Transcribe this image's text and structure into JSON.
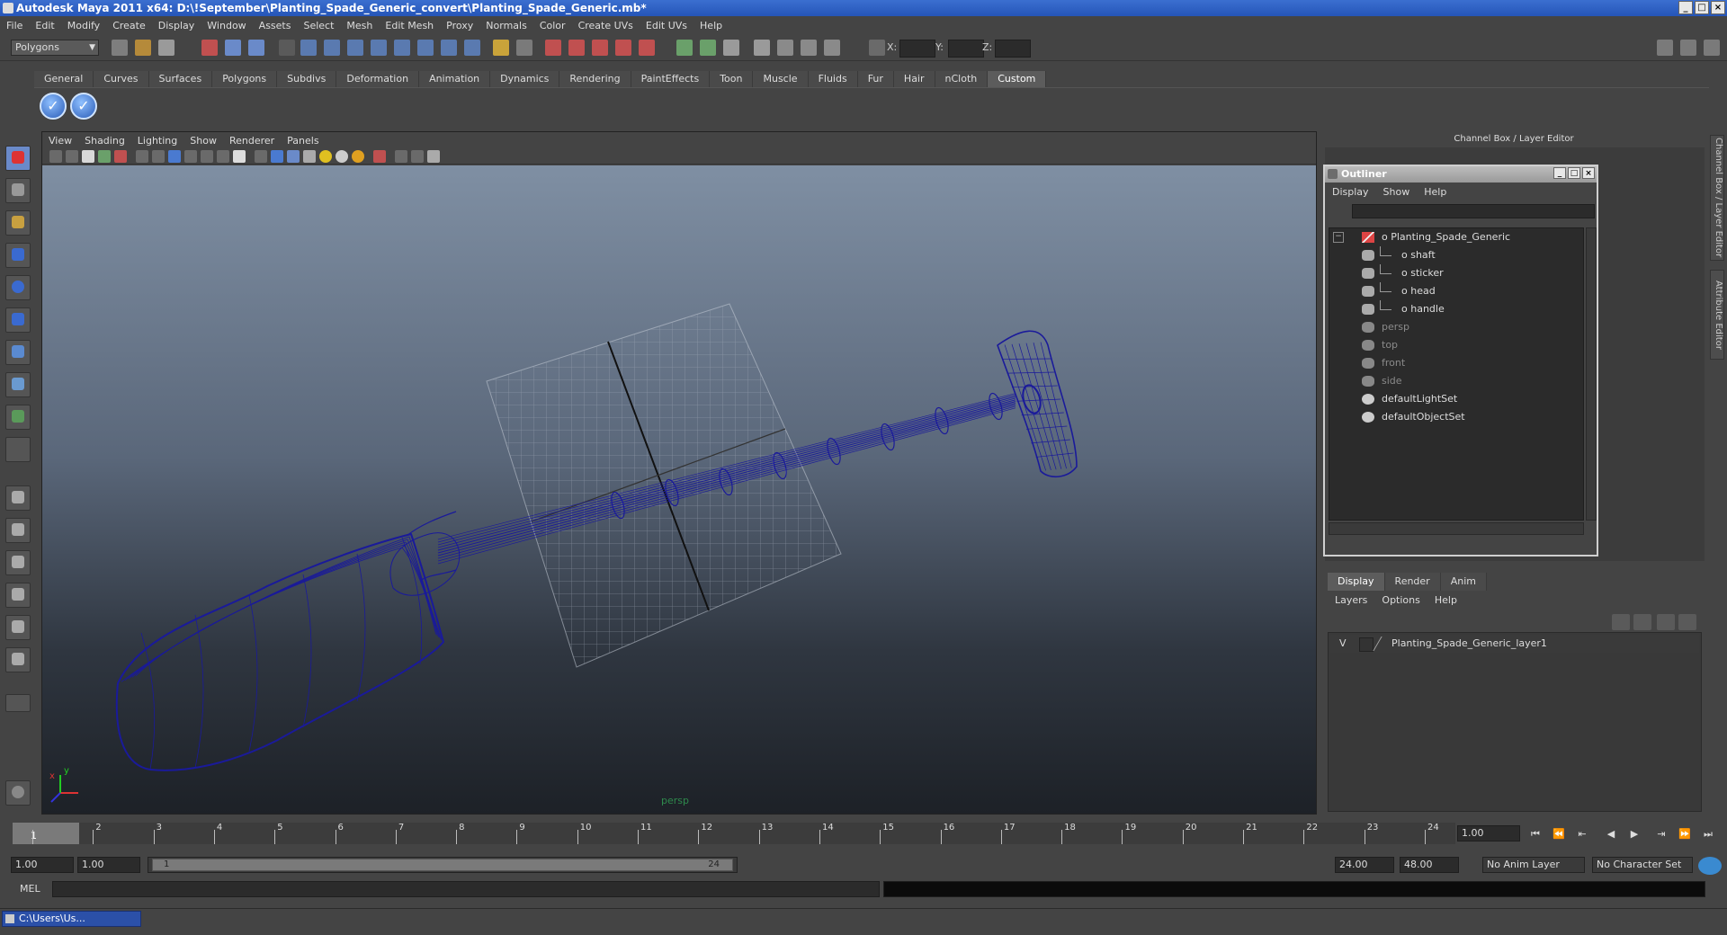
{
  "window": {
    "title": "Autodesk Maya 2011 x64: D:\\!September\\Planting_Spade_Generic_convert\\Planting_Spade_Generic.mb*",
    "minimize": "_",
    "maximize": "□",
    "close": "×"
  },
  "menubar": [
    "File",
    "Edit",
    "Modify",
    "Create",
    "Display",
    "Window",
    "Assets",
    "Select",
    "Mesh",
    "Edit Mesh",
    "Proxy",
    "Normals",
    "Color",
    "Create UVs",
    "Edit UVs",
    "Help"
  ],
  "statusline": {
    "mode": "Polygons",
    "x_label": "X:",
    "y_label": "Y:",
    "z_label": "Z:"
  },
  "shelf": {
    "tabs": [
      "General",
      "Curves",
      "Surfaces",
      "Polygons",
      "Subdivs",
      "Deformation",
      "Animation",
      "Dynamics",
      "Rendering",
      "PaintEffects",
      "Toon",
      "Muscle",
      "Fluids",
      "Fur",
      "Hair",
      "nCloth",
      "Custom"
    ],
    "active_tab": "Custom",
    "button_glyph": "✓"
  },
  "viewport": {
    "menu": [
      "View",
      "Shading",
      "Lighting",
      "Show",
      "Renderer",
      "Panels"
    ],
    "camera": "persp",
    "axis_x": "x",
    "axis_y": "y",
    "wire_color": "#1a1a9a"
  },
  "channelbox": {
    "title": "Channel Box / Layer Editor",
    "side_tabs": [
      "Channel Box / Layer Editor",
      "Attribute Editor"
    ]
  },
  "outliner": {
    "title": "Outliner",
    "menu": [
      "Display",
      "Show",
      "Help"
    ],
    "expand": "−",
    "items": [
      {
        "label": "Planting_Spade_Generic",
        "indent": 0,
        "dim": false
      },
      {
        "label": "shaft",
        "indent": 1,
        "dim": false
      },
      {
        "label": "sticker",
        "indent": 1,
        "dim": false
      },
      {
        "label": "head",
        "indent": 1,
        "dim": false
      },
      {
        "label": "handle",
        "indent": 1,
        "dim": false
      },
      {
        "label": "persp",
        "indent": 0,
        "dim": true
      },
      {
        "label": "top",
        "indent": 0,
        "dim": true
      },
      {
        "label": "front",
        "indent": 0,
        "dim": true
      },
      {
        "label": "side",
        "indent": 0,
        "dim": true
      },
      {
        "label": "defaultLightSet",
        "indent": 0,
        "dim": false
      },
      {
        "label": "defaultObjectSet",
        "indent": 0,
        "dim": false
      }
    ]
  },
  "layer_editor": {
    "tabs": [
      "Display",
      "Render",
      "Anim"
    ],
    "active_tab": "Display",
    "menu": [
      "Layers",
      "Options",
      "Help"
    ],
    "layer_visible": "V",
    "layer_name": "Planting_Spade_Generic_layer1"
  },
  "timeline": {
    "ticks": [
      "1",
      "2",
      "3",
      "4",
      "5",
      "6",
      "7",
      "8",
      "9",
      "10",
      "11",
      "12",
      "13",
      "14",
      "15",
      "16",
      "17",
      "18",
      "19",
      "20",
      "21",
      "22",
      "23",
      "24"
    ],
    "current_frame": "1",
    "current_field": "1.00",
    "playback": [
      "⏮",
      "⏪",
      "⇤",
      "◀",
      "▶",
      "⇥",
      "⏩",
      "⏭"
    ]
  },
  "range": {
    "start": "1.00",
    "playback_start": "1.00",
    "slider_start": "1",
    "slider_end": "24",
    "playback_end": "24.00",
    "end": "48.00",
    "anim_layer": "No Anim Layer",
    "character_set": "No Character Set"
  },
  "commandline": {
    "mode": "MEL"
  },
  "taskbar": {
    "item": "C:\\Users\\Us..."
  }
}
